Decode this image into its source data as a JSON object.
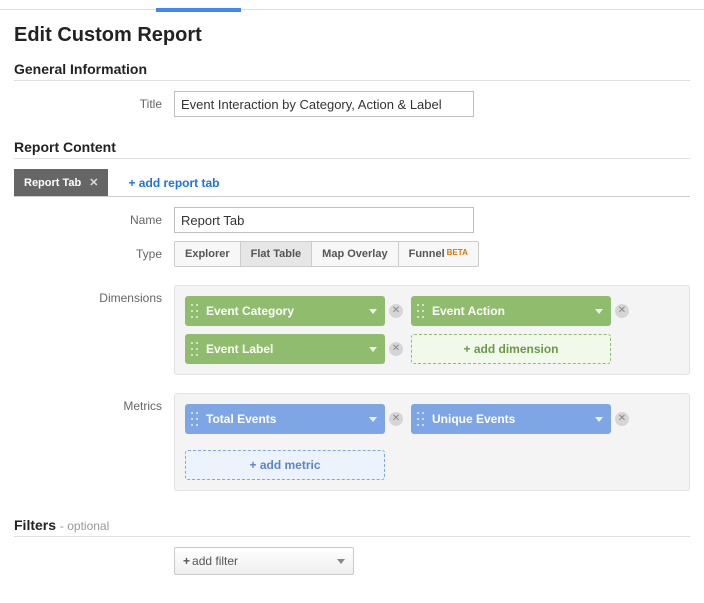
{
  "page_title": "Edit Custom Report",
  "sections": {
    "general": {
      "title": "General Information"
    },
    "content": {
      "title": "Report Content"
    },
    "filters": {
      "title": "Filters",
      "optional": "- optional"
    }
  },
  "fields": {
    "title": {
      "label": "Title",
      "value": "Event Interaction by Category, Action & Label"
    },
    "name": {
      "label": "Name",
      "value": "Report Tab"
    },
    "type": {
      "label": "Type"
    },
    "dimensions": {
      "label": "Dimensions"
    },
    "metrics": {
      "label": "Metrics"
    }
  },
  "tabs": {
    "active": "Report Tab",
    "add_label": "+ add report tab"
  },
  "type_buttons": {
    "explorer": "Explorer",
    "flat_table": "Flat Table",
    "map_overlay": "Map Overlay",
    "funnel": "Funnel",
    "beta": "BETA"
  },
  "dimensions": {
    "items": [
      "Event Category",
      "Event Action",
      "Event Label"
    ],
    "add_label": "+ add dimension"
  },
  "metrics": {
    "items": [
      "Total Events",
      "Unique Events"
    ],
    "add_label": "+ add metric"
  },
  "filter_add": "add filter"
}
